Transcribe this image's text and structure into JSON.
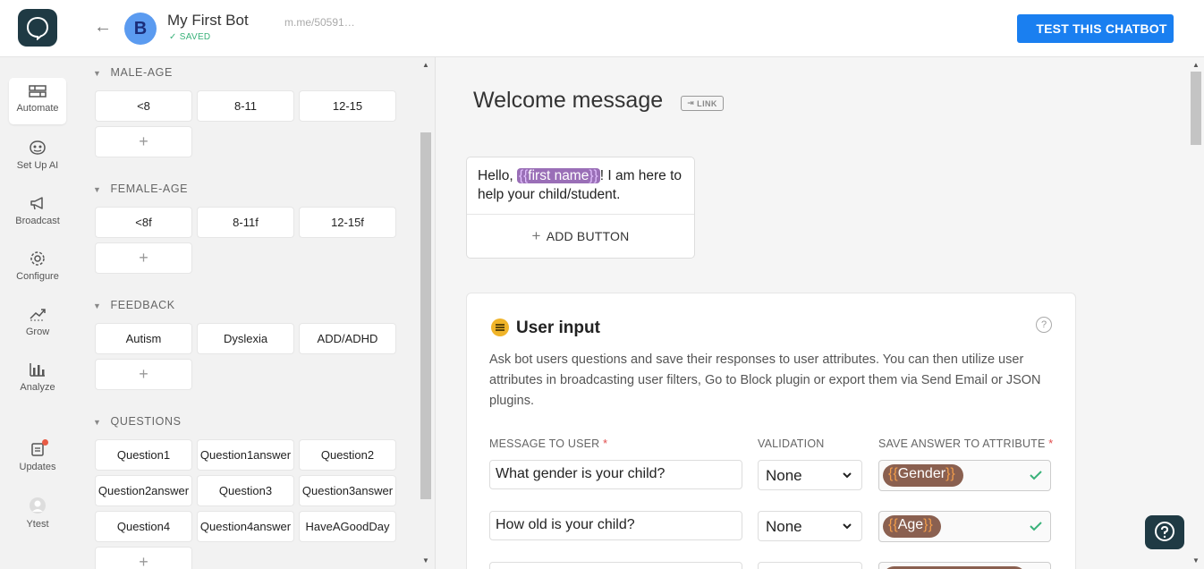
{
  "header": {
    "bot_avatar_letter": "B",
    "bot_name": "My First Bot",
    "saved_label": "SAVED",
    "bot_link": "m.me/50591…",
    "test_button_label": "TEST THIS CHATBOT",
    "brand_color": "#1f3a44",
    "accent_color": "#1a7ff0"
  },
  "nav": {
    "items": [
      {
        "label": "Automate",
        "icon": "automate-icon",
        "active": true
      },
      {
        "label": "Set Up AI",
        "icon": "ai-icon"
      },
      {
        "label": "Broadcast",
        "icon": "megaphone-icon"
      },
      {
        "label": "Configure",
        "icon": "gear-icon"
      },
      {
        "label": "Grow",
        "icon": "grow-icon"
      },
      {
        "label": "Analyze",
        "icon": "bar-chart-icon"
      },
      {
        "label": "Updates",
        "icon": "updates-icon"
      },
      {
        "label": "Ytest",
        "icon": "user-icon"
      }
    ]
  },
  "groups": [
    {
      "title": "MALE-AGE",
      "blocks": [
        "<8",
        "8-11",
        "12-15"
      ]
    },
    {
      "title": "FEMALE-AGE",
      "blocks": [
        "<8f",
        "8-11f",
        "12-15f"
      ]
    },
    {
      "title": "FEEDBACK",
      "blocks": [
        "Autism",
        "Dyslexia",
        "ADD/ADHD"
      ]
    },
    {
      "title": "QUESTIONS",
      "blocks": [
        "Question1",
        "Question1answer",
        "Question2",
        "Question2answer",
        "Question3",
        "Question3answer",
        "Question4",
        "Question4answer",
        "HaveAGoodDay"
      ]
    }
  ],
  "add_block_symbol": "+",
  "main": {
    "block_title": "Welcome message",
    "link_tag": "LINK",
    "message": {
      "before": "Hello, ",
      "attr_open": "{{",
      "attr_name": "first name",
      "attr_close": "}}",
      "after": "! I am here to help your child/student."
    },
    "add_button_label": "ADD BUTTON",
    "user_input": {
      "title": "User input",
      "help": "?",
      "description": "Ask bot users questions and save their responses to user attributes. You can then utilize user attributes in broadcasting user filters, Go to Block plugin or export them via Send Email or JSON plugins.",
      "col_message": "MESSAGE TO USER",
      "col_validation": "VALIDATION",
      "col_attribute": "SAVE ANSWER TO ATTRIBUTE",
      "required_mark": "*",
      "rows": [
        {
          "message": "What gender is your child?",
          "validation": "None",
          "attribute": "Gender"
        },
        {
          "message": "How old is your child?",
          "validation": "None",
          "attribute": "Age"
        }
      ],
      "brace_open": "{{",
      "brace_close": "}}"
    }
  }
}
